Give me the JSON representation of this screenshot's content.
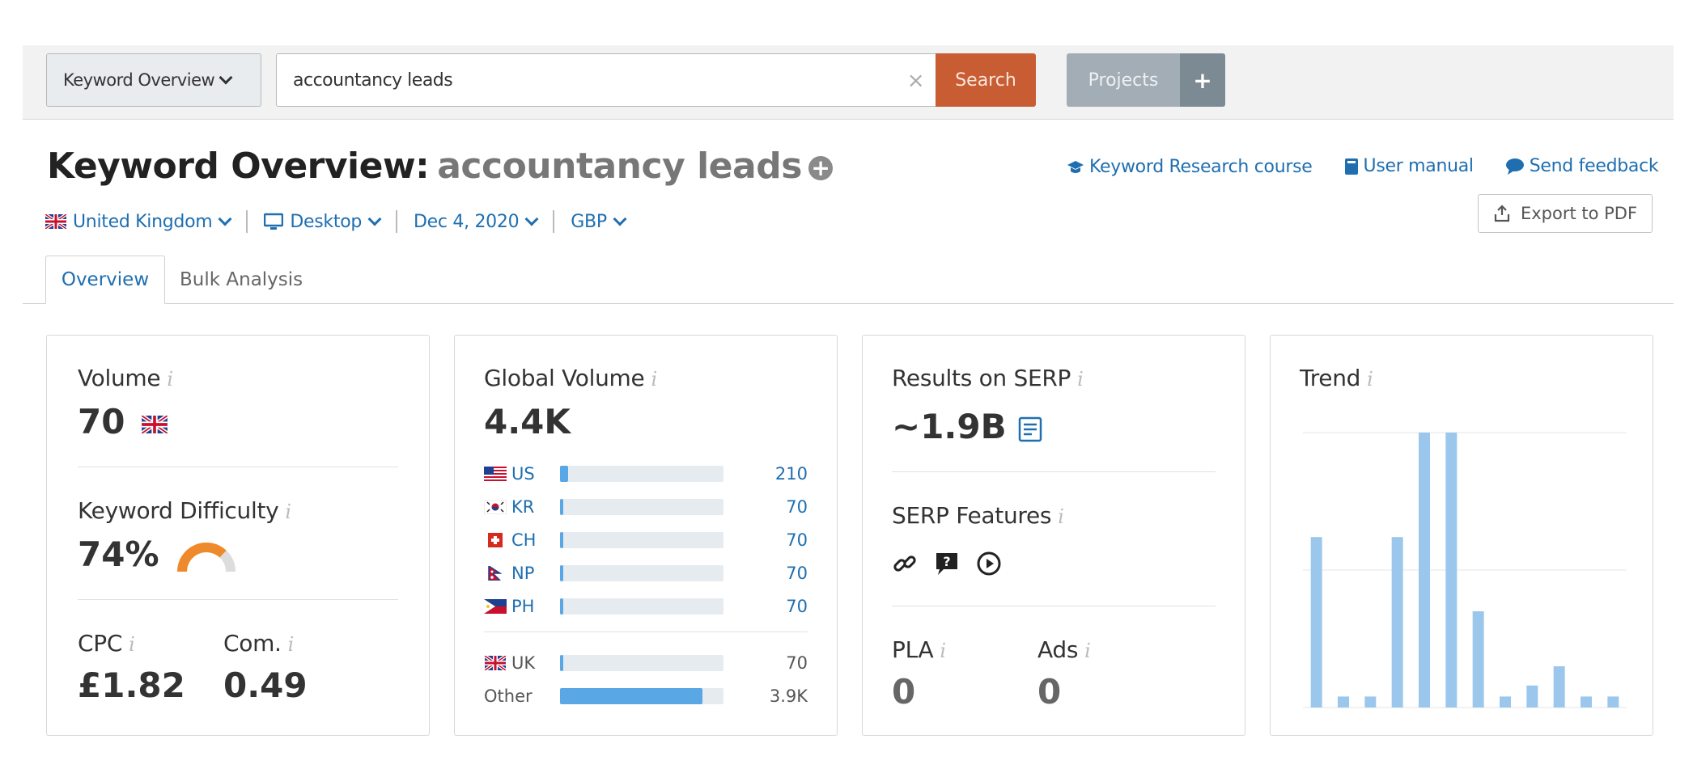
{
  "topbar": {
    "tool_select": "Keyword Overview",
    "search_value": "accountancy leads",
    "clear_symbol": "×",
    "search_label": "Search",
    "projects_label": "Projects",
    "projects_add": "+"
  },
  "header": {
    "title": "Keyword Overview:",
    "keyword": "accountancy leads",
    "links": {
      "course": "Keyword Research course",
      "manual": "User manual",
      "feedback": "Send feedback"
    },
    "export_label": "Export to PDF",
    "filters": {
      "country": "United Kingdom",
      "device": "Desktop",
      "date": "Dec 4, 2020",
      "currency": "GBP"
    }
  },
  "tabs": {
    "overview": "Overview",
    "bulk": "Bulk Analysis"
  },
  "volume_card": {
    "volume_label": "Volume",
    "volume_value": "70",
    "kd_label": "Keyword Difficulty",
    "kd_value": "74%",
    "kd_percent": 74,
    "cpc_label": "CPC",
    "cpc_value": "£1.82",
    "com_label": "Com.",
    "com_value": "0.49"
  },
  "global_card": {
    "label": "Global Volume",
    "value": "4.4K",
    "rows": [
      {
        "code": "US",
        "value": "210",
        "fill": 0.05,
        "flag": "us"
      },
      {
        "code": "KR",
        "value": "70",
        "fill": 0.02,
        "flag": "kr"
      },
      {
        "code": "CH",
        "value": "70",
        "fill": 0.02,
        "flag": "ch"
      },
      {
        "code": "NP",
        "value": "70",
        "fill": 0.02,
        "flag": "np"
      },
      {
        "code": "PH",
        "value": "70",
        "fill": 0.02,
        "flag": "ph"
      }
    ],
    "uk": {
      "code": "UK",
      "value": "70",
      "fill": 0.02
    },
    "other": {
      "code": "Other",
      "value": "3.9K",
      "fill": 0.87
    }
  },
  "serp_card": {
    "results_label": "Results on SERP",
    "results_value": "~1.9B",
    "features_label": "SERP Features",
    "feature_icons": [
      "link-icon",
      "faq-icon",
      "video-icon"
    ],
    "pla_label": "PLA",
    "pla_value": "0",
    "ads_label": "Ads",
    "ads_value": "0"
  },
  "trend_card": {
    "label": "Trend"
  },
  "chart_data": {
    "type": "bar",
    "title": "Trend",
    "values": [
      0.62,
      0.04,
      0.04,
      0.62,
      1.0,
      1.0,
      0.35,
      0.04,
      0.08,
      0.15,
      0.04,
      0.04
    ],
    "ylim": [
      0,
      1
    ],
    "grid": true,
    "color": "#9cc7ec"
  },
  "colors": {
    "accent": "#1f6fb0",
    "search_btn": "#c85d33",
    "kd_gauge": "#ee8a2b",
    "bar_fill": "#5aa7e6"
  }
}
